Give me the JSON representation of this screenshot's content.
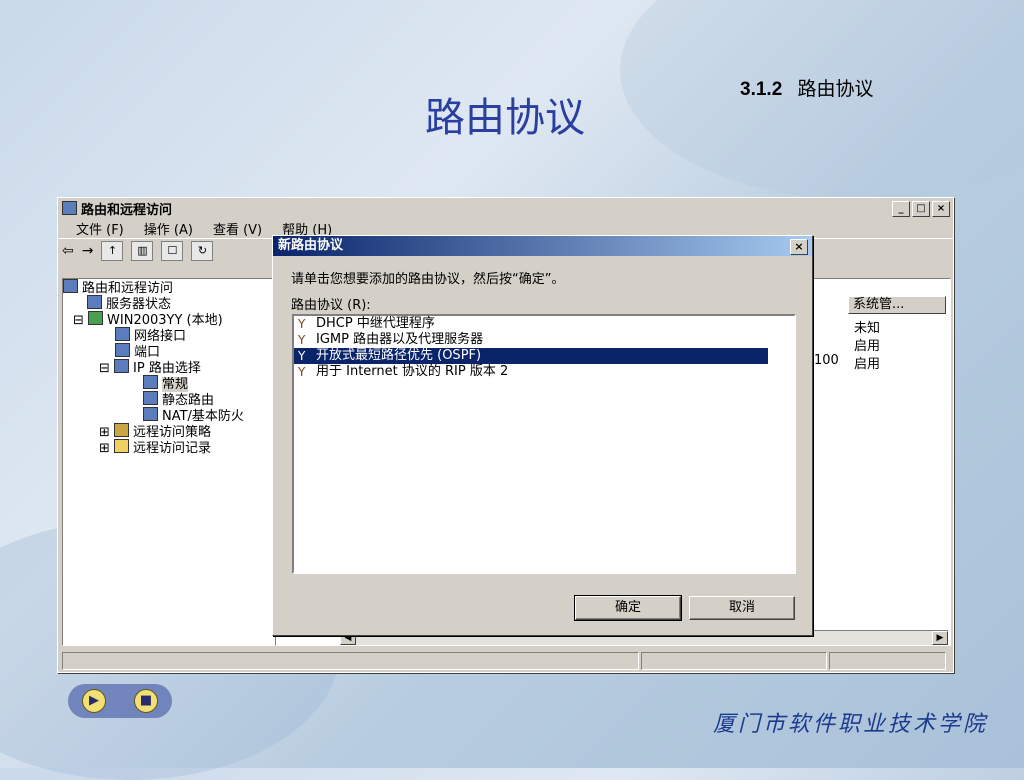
{
  "slide": {
    "title": "路由协议",
    "section_number": "3.1.2",
    "section_title": "路由协议",
    "footer": "厦门市软件职业技术学院",
    "nav": {
      "play_icon": "play-icon",
      "stop_icon": "stop-icon"
    }
  },
  "window": {
    "title": "路由和远程访问",
    "controls": [
      "_",
      "□",
      "×"
    ],
    "menu": [
      "文件 (F)",
      "操作 (A)",
      "查看 (V)",
      "帮助 (H)"
    ],
    "tree": [
      {
        "label": "路由和远程访问",
        "indent": 0
      },
      {
        "label": "服务器状态",
        "indent": 1
      },
      {
        "label": "WIN2003YY (本地)",
        "indent": 1
      },
      {
        "label": "网络接口",
        "indent": 2
      },
      {
        "label": "端口",
        "indent": 2
      },
      {
        "label": "IP 路由选择",
        "indent": 2
      },
      {
        "label": "常规",
        "indent": 3
      },
      {
        "label": "静态路由",
        "indent": 3
      },
      {
        "label": "NAT/基本防火",
        "indent": 3
      },
      {
        "label": "远程访问策略",
        "indent": 2
      },
      {
        "label": "远程访问记录",
        "indent": 2
      }
    ],
    "column_header": "系统管...",
    "rows": [
      {
        "num": "",
        "status": "未知"
      },
      {
        "num": "",
        "status": "启用"
      },
      {
        "num": "100",
        "status": "启用"
      }
    ]
  },
  "dialog": {
    "title": "新路由协议",
    "close": "×",
    "prompt": "请单击您想要添加的路由协议，然后按“确定”。",
    "list_label": "路由协议 (R):",
    "protocols": [
      "DHCP 中继代理程序",
      "IGMP 路由器以及代理服务器",
      "开放式最短路径优先 (OSPF)",
      "用于 Internet 协议的 RIP 版本 2"
    ],
    "selected_index": 2,
    "ok_label": "确定",
    "cancel_label": "取消"
  }
}
